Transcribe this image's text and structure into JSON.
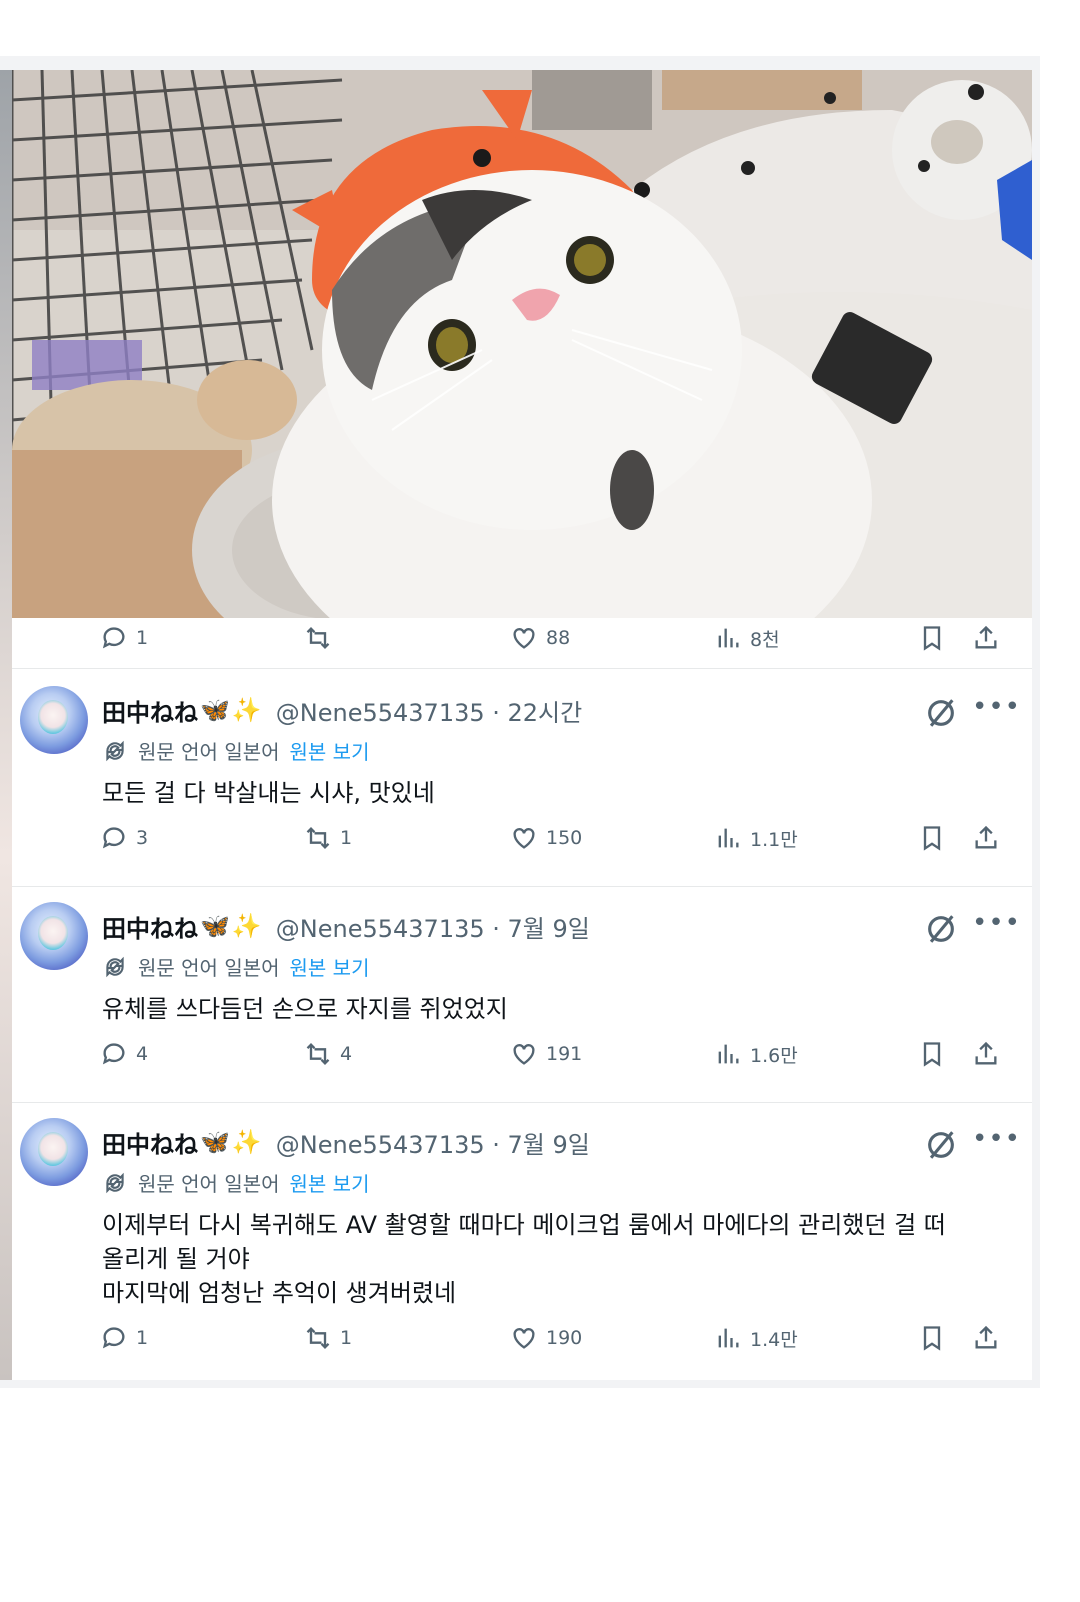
{
  "top_post": {
    "actions": {
      "replies": "1",
      "reposts": "",
      "likes": "88",
      "views": "8천"
    }
  },
  "translation_notice": {
    "label": "원문 언어 일본어",
    "link": "원본 보기"
  },
  "replies": [
    {
      "name": "田中ねね",
      "emoji_1": "🦋",
      "emoji_2": "✨",
      "handle_time": "@Nene55437135 · 22시간",
      "lines": [
        "모든 걸 다 박살내는 시샤, 맛있네"
      ],
      "actions": {
        "replies": "3",
        "reposts": "1",
        "likes": "150",
        "views": "1.1만"
      }
    },
    {
      "name": "田中ねね",
      "emoji_1": "🦋",
      "emoji_2": "✨",
      "handle_time": "@Nene55437135 · 7월 9일",
      "lines": [
        "유체를 쓰다듬던 손으로 자지를 쥐었었지"
      ],
      "actions": {
        "replies": "4",
        "reposts": "4",
        "likes": "191",
        "views": "1.6만"
      }
    },
    {
      "name": "田中ねね",
      "emoji_1": "🦋",
      "emoji_2": "✨",
      "handle_time": "@Nene55437135 · 7월 9일",
      "lines": [
        "이제부터 다시 복귀해도 AV 촬영할 때마다 메이크업 룸에서 마에다의 관리했던 걸 떠",
        "올리게 될 거야",
        "마지막에 엄청난 추억이 생겨버렸네"
      ],
      "actions": {
        "replies": "1",
        "reposts": "1",
        "likes": "190",
        "views": "1.4만"
      }
    }
  ]
}
